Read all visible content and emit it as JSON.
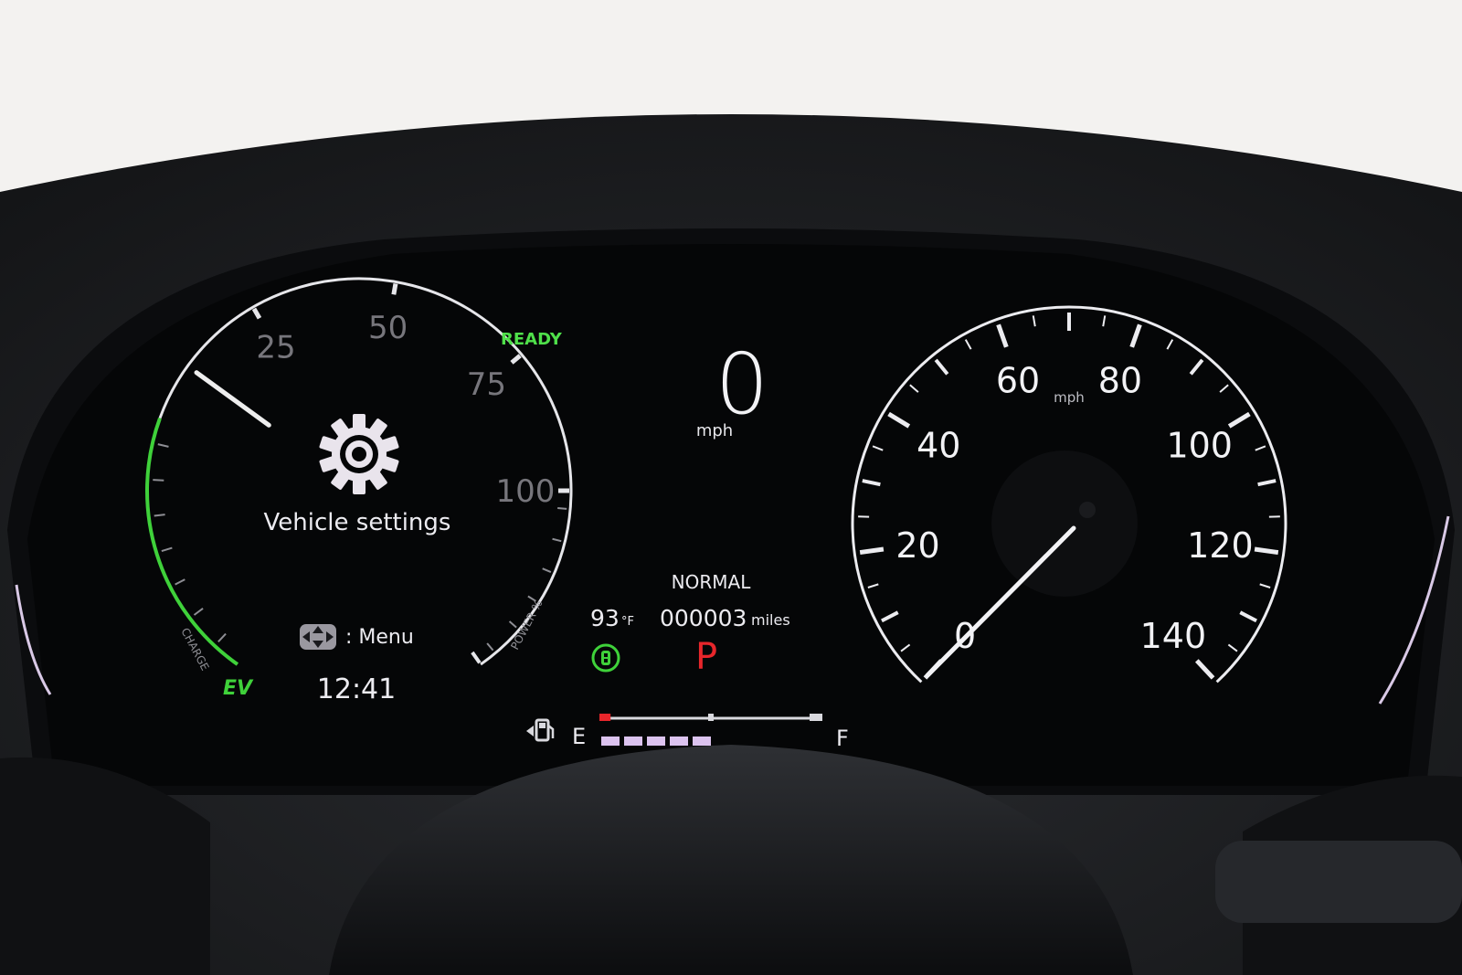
{
  "power_gauge": {
    "tick_labels": [
      "25",
      "50",
      "75",
      "100"
    ],
    "label_charge": "CHARGE",
    "label_power": "POWER %",
    "ev_indicator": "EV",
    "ready_indicator": "READY",
    "needle_value": 10,
    "colors": {
      "charge_arc": "#3fd13a",
      "ready": "#4fe04a",
      "ev": "#3fd13a"
    }
  },
  "center_panel": {
    "icon": "gear-icon",
    "title": "Vehicle settings",
    "menu_icon": "dpad-icon",
    "menu_hint": ": Menu",
    "clock": "12:41"
  },
  "digital_speed": {
    "value": "0",
    "unit": "mph"
  },
  "info": {
    "drive_mode": "NORMAL",
    "temperature": "93",
    "temperature_unit": "°F",
    "odometer": "000003",
    "odometer_unit": "miles",
    "gear": "P",
    "gear_color": "#e8262b",
    "eco_icon": "eco-indicator-icon"
  },
  "fuel": {
    "icon": "fuel-pump-icon",
    "empty_label": "E",
    "full_label": "F",
    "level_fraction": 0.05
  },
  "speedometer": {
    "unit": "mph",
    "tick_labels": [
      "0",
      "20",
      "40",
      "60",
      "80",
      "100",
      "120",
      "140"
    ],
    "max": 140,
    "needle_value": 0
  }
}
